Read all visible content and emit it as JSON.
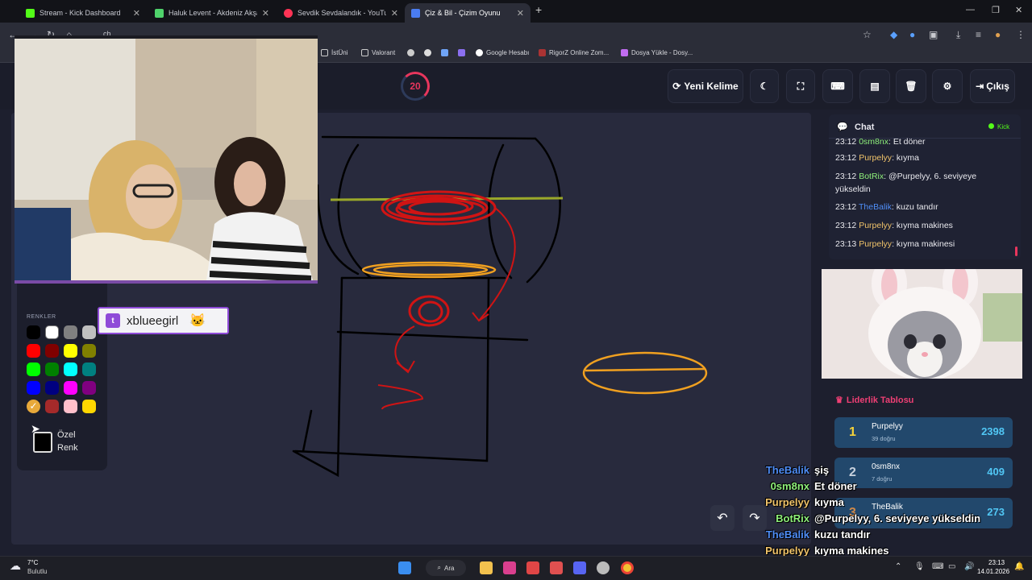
{
  "tabs": [
    {
      "title": "Stream - Kick Dashboard",
      "color": "#53fc18"
    },
    {
      "title": "Haluk Levent - Akdeniz Akşamları",
      "color": "#4fd26b"
    },
    {
      "title": "Sevdik Sevdalandık - YouTube",
      "color": "#ff3355"
    },
    {
      "title": "Çiz & Bil - Çizim Oyunu",
      "color": "#4a7cf0"
    }
  ],
  "address": {
    "prefix": "ch"
  },
  "bookmarks": [
    "İstÜni",
    "Valorant",
    "Google Hesabı",
    "RigorZ Online Zom...",
    "Dosya Yükle - Dosy..."
  ],
  "timer": "20",
  "header_buttons": {
    "new_word": "Yeni Kelime",
    "logout": "Çıkış"
  },
  "colors_panel": {
    "label": "RENKLER",
    "custom_label_1": "Özel",
    "custom_label_2": "Renk",
    "swatches": [
      "#000000",
      "#ffffff",
      "#808080",
      "#c0c0c0",
      "#ff0000",
      "#800000",
      "#ffff00",
      "#808000",
      "#00ff00",
      "#008000",
      "#00ffff",
      "#008080",
      "#0000ff",
      "#000080",
      "#ff00ff",
      "#800080",
      "#e8a93a",
      "#a52a2a",
      "#ffc0cb",
      "#ffd700"
    ]
  },
  "webcam": {
    "username": "xblueegirl"
  },
  "chat": {
    "title": "Chat",
    "badge": "Kick",
    "messages": [
      {
        "time": "23:12",
        "user": "0sm8nx",
        "text": "Et döner",
        "color": "#8ef07a"
      },
      {
        "time": "23:12",
        "user": "Purpelyy",
        "text": "kıyma",
        "color": "#f0c36a"
      },
      {
        "time": "23:12",
        "user": "BotRix",
        "text": "@Purpelyy, 6. seviyeye yükseldin",
        "color": "#8ef07a"
      },
      {
        "time": "23:12",
        "user": "TheBalik",
        "text": "kuzu tandır",
        "color": "#4f8ef7"
      },
      {
        "time": "23:12",
        "user": "Purpelyy",
        "text": "kıyma makines",
        "color": "#f0c36a"
      },
      {
        "time": "23:13",
        "user": "Purpelyy",
        "text": "kıyma makinesi",
        "color": "#f0c36a"
      }
    ]
  },
  "leaderboard": {
    "title": "Liderlik Tablosu",
    "rows": [
      {
        "rank": "1",
        "name": "Purpelyy",
        "sub": "39 doğru",
        "score": "2398",
        "rank_color": "#f5d33a"
      },
      {
        "rank": "2",
        "name": "0sm8nx",
        "sub": "7 doğru",
        "score": "409",
        "rank_color": "#c9d2de"
      },
      {
        "rank": "3",
        "name": "TheBalik",
        "sub": "",
        "score": "273",
        "rank_color": "#d08a4a"
      }
    ]
  },
  "overlay_chat": [
    {
      "user": "TheBalik",
      "text": "şiş",
      "color": "#4f8ef7"
    },
    {
      "user": "0sm8nx",
      "text": "Et döner",
      "color": "#8ef07a"
    },
    {
      "user": "Purpelyy",
      "text": "kıyma",
      "color": "#f0c36a"
    },
    {
      "user": "BotRix",
      "text": "@Purpelyy, 6. seviyeye yükseldin",
      "color": "#8ef07a"
    },
    {
      "user": "TheBalik",
      "text": "kuzu tandır",
      "color": "#4f8ef7"
    },
    {
      "user": "Purpelyy",
      "text": "kıyma makines",
      "color": "#f0c36a"
    },
    {
      "user": "Purpelyy",
      "text": "kıyma makinesi",
      "color": "#f0c36a"
    }
  ],
  "taskbar": {
    "weather_temp": "7°C",
    "weather_desc": "Bulutlu",
    "search": "Ara",
    "time": "23:13",
    "date": "14.01.2026"
  }
}
